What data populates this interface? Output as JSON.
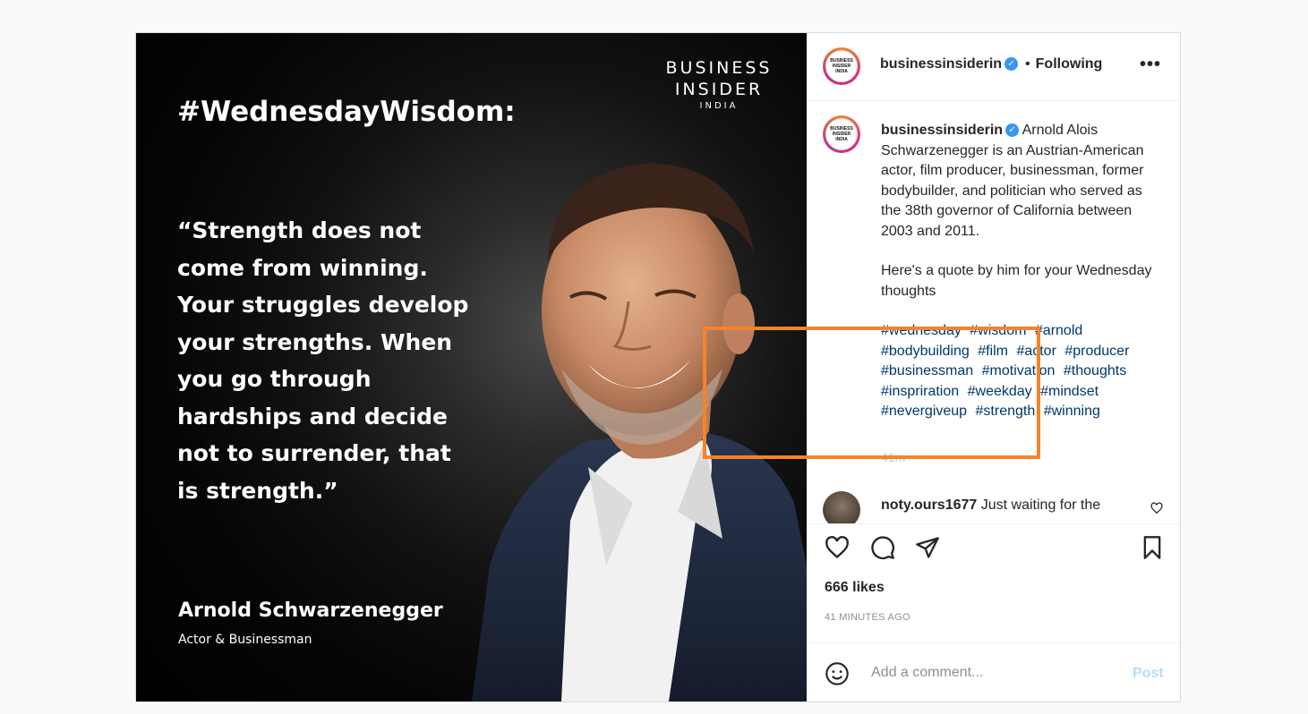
{
  "image": {
    "brand_line1": "BUSINESS",
    "brand_line2": "INSIDER",
    "brand_line3": "INDIA",
    "headline": "#WednesdayWisdom:",
    "quote": "“Strength does not come from winning. Your struggles develop your strengths. When you go through hardships and decide not to surrender, that is strength.”",
    "author_name": "Arnold Schwarzenegger",
    "author_role": "Actor & Businessman"
  },
  "header": {
    "avatar_text": [
      "BUSINESS",
      "INSIDER",
      "INDIA"
    ],
    "username": "businessinsiderin",
    "separator": "•",
    "follow_status": "Following",
    "more_label": "•••"
  },
  "caption": {
    "username": "businessinsiderin",
    "text": "Arnold Alois Schwarzenegger is an Austrian-American actor, film producer, businessman, former bodybuilder, and politician who served as the 38th governor of California between 2003 and 2011.",
    "para2": "Here's a quote by him for your Wednesday thoughts",
    "hashtags": [
      "#wednesday",
      "#wisdom",
      "#arnold",
      "#bodybuilding",
      "#film",
      "#actor",
      "#producer",
      "#businessman",
      "#motivation",
      "#thoughts",
      "#inspriration",
      "#weekday",
      "#mindset",
      "#nevergiveup",
      "#strength",
      "#winning"
    ],
    "faded_text": "41m"
  },
  "comments": [
    {
      "username": "noty.ours1677",
      "text": "Just waiting for the"
    }
  ],
  "actions": {
    "likes": "666 likes",
    "timestamp": "41 MINUTES AGO"
  },
  "add_comment": {
    "placeholder": "Add a comment...",
    "post_label": "Post"
  },
  "colors": {
    "highlight_box": "#f5832a",
    "link": "#00376b",
    "verified": "#3897f0",
    "post_disabled": "#b2dffc"
  }
}
